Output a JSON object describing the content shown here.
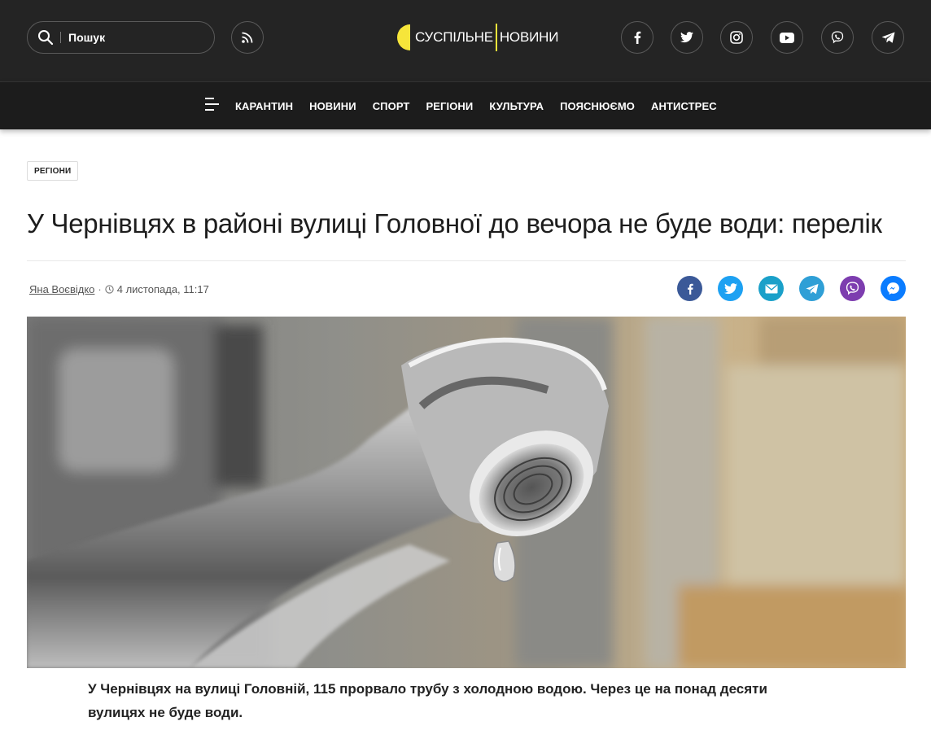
{
  "header": {
    "search_placeholder": "Пошук",
    "logo_text_left": "СУСПІЛЬНЕ",
    "logo_text_right": "НОВИНИ",
    "social_icons": [
      "facebook-icon",
      "twitter-icon",
      "instagram-icon",
      "youtube-icon",
      "viber-icon",
      "telegram-icon"
    ]
  },
  "nav": {
    "items": [
      {
        "label": "КАРАНТИН"
      },
      {
        "label": "НОВИНИ"
      },
      {
        "label": "СПОРТ"
      },
      {
        "label": "РЕГІОНИ"
      },
      {
        "label": "КУЛЬТУРА"
      },
      {
        "label": "ПОЯСНЮЄМО"
      },
      {
        "label": "АНТИСТРЕС"
      }
    ]
  },
  "article": {
    "category": "РЕГІОНИ",
    "title": "У Чернівцях в районі вулиці Головної до вечора не буде води: перелік",
    "author": "Яна Воєвідко",
    "separator": "·",
    "date": "4 листопада, 11:17",
    "share_icons": [
      "facebook-share-icon",
      "twitter-share-icon",
      "email-share-icon",
      "telegram-share-icon",
      "viber-share-icon",
      "messenger-share-icon"
    ],
    "lead": "У Чернівцях на вулиці Головній, 115 прорвало трубу з холодною водою. Через це на понад десяти вулицях не буде води."
  },
  "colors": {
    "header_bg": "#242424",
    "nav_bg": "#1c1c1c",
    "logo_yellow": "#f6e53a",
    "facebook": "#3b5998",
    "twitter": "#1da1f2",
    "email": "#1aa0c9",
    "telegram": "#2f9fd6",
    "viber": "#7d3daf",
    "messenger": "#0a7cff"
  }
}
